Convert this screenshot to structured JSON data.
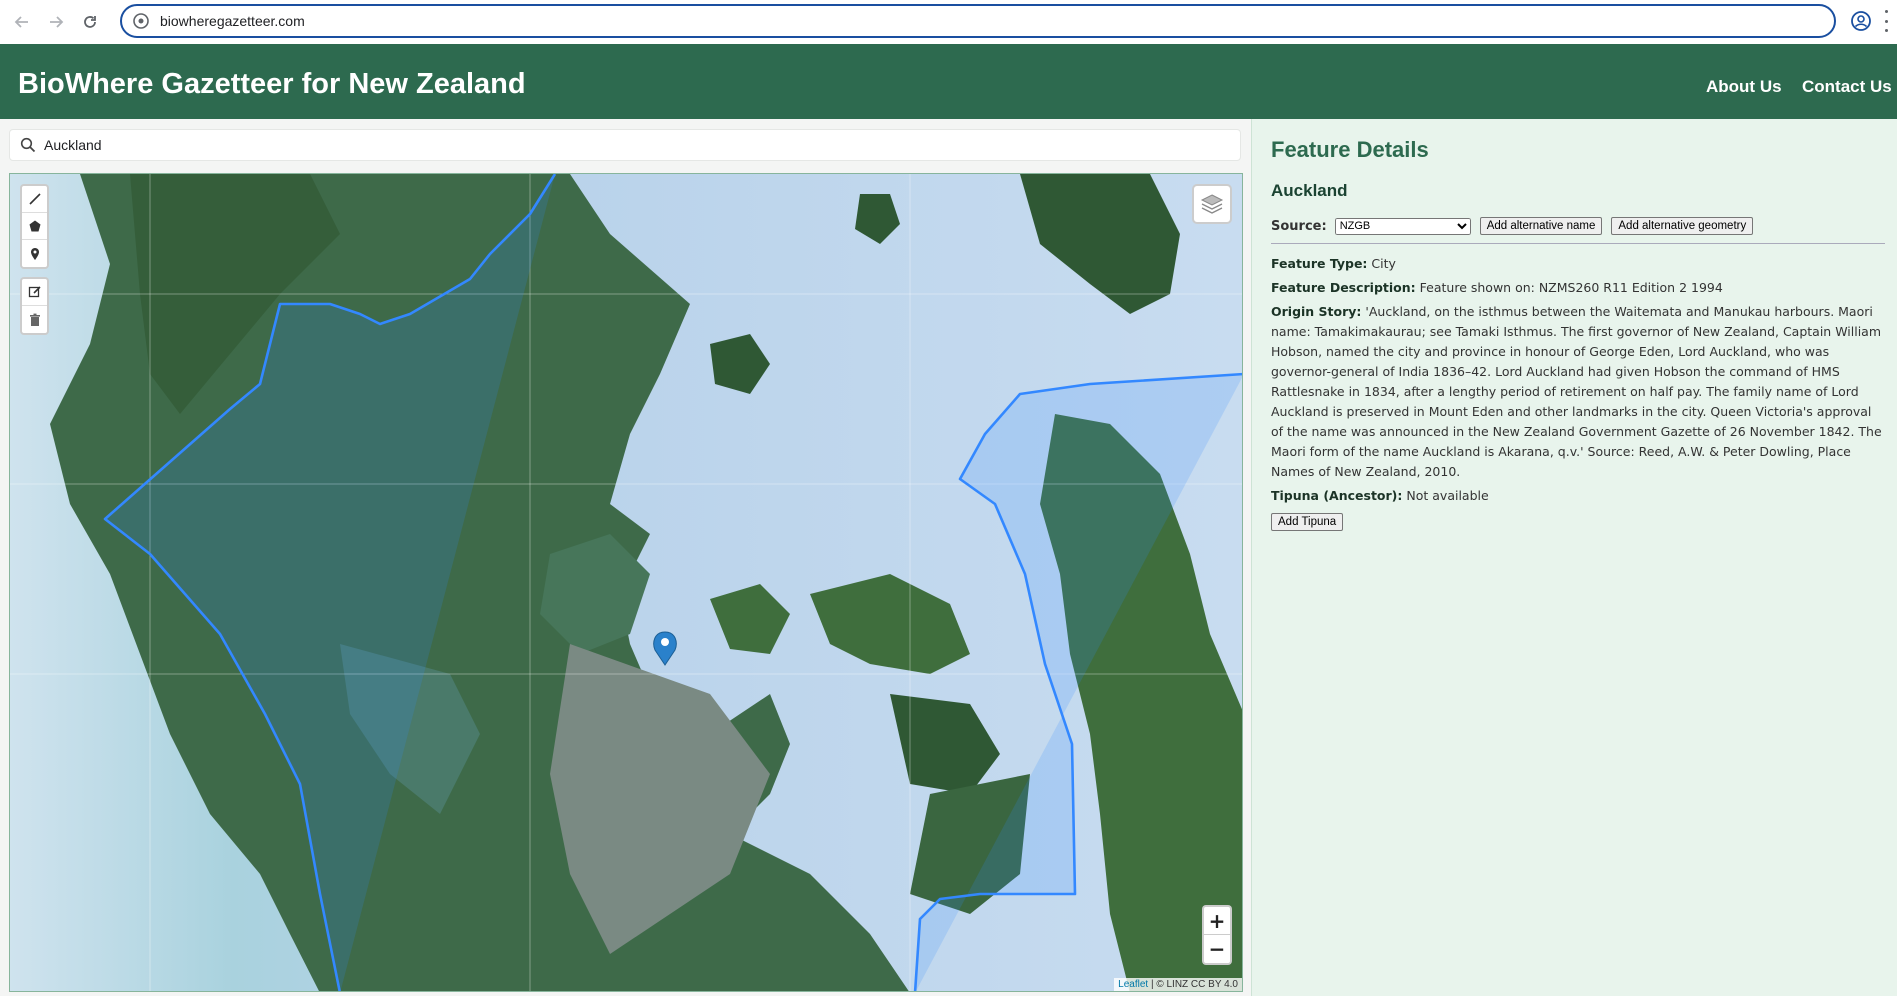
{
  "browser": {
    "url": "biowheregazetteer.com"
  },
  "header": {
    "title": "BioWhere Gazetteer for New Zealand",
    "nav": [
      "About Us",
      "Contact Us"
    ]
  },
  "search": {
    "value": "Auckland"
  },
  "map": {
    "attribution_link": "Leaflet",
    "attribution_text": " | © LINZ CC BY 4.0",
    "zoom_in": "+",
    "zoom_out": "−",
    "draw_tools": [
      "polyline-icon",
      "polygon-icon",
      "marker-icon"
    ],
    "edit_tools": [
      "edit-icon",
      "trash-icon"
    ]
  },
  "details": {
    "panel_title": "Feature Details",
    "feature_name": "Auckland",
    "source_label": "Source:",
    "source_selected": "NZGB",
    "add_alt_name": "Add alternative name",
    "add_alt_geometry": "Add alternative geometry",
    "feature_type_label": "Feature Type:",
    "feature_type": "City",
    "feature_desc_label": "Feature Description:",
    "feature_desc": "Feature shown on: NZMS260 R11 Edition 2 1994",
    "origin_label": "Origin Story:",
    "origin_story": "'Auckland, on the isthmus between the Waitemata and Manukau harbours. Maori name: Tamakimakaurau; see Tamaki Isthmus. The first governor of New Zealand, Captain William Hobson, named the city and province in honour of George Eden, Lord Auckland, who was governor-general of India 1836–42. Lord Auckland had given Hobson the command of HMS Rattlesnake in 1834, after a lengthy period of retirement on half pay. The family name of Lord Auckland is preserved in Mount Eden and other landmarks in the city. Queen Victoria's approval of the name was announced in the New Zealand Government Gazette of 26 November 1842. The Maori form of the name Auckland is Akarana, q.v.' Source: Reed, A.W. & Peter Dowling, Place Names of New Zealand, 2010.",
    "tipuna_label": "Tipuna (Ancestor):",
    "tipuna": "Not available",
    "add_tipuna": "Add Tipuna"
  },
  "colors": {
    "header_bg": "#2d6a4f",
    "panel_bg": "#e8f4ec",
    "boundary": "#3388ff",
    "marker": "#2a81cb"
  }
}
